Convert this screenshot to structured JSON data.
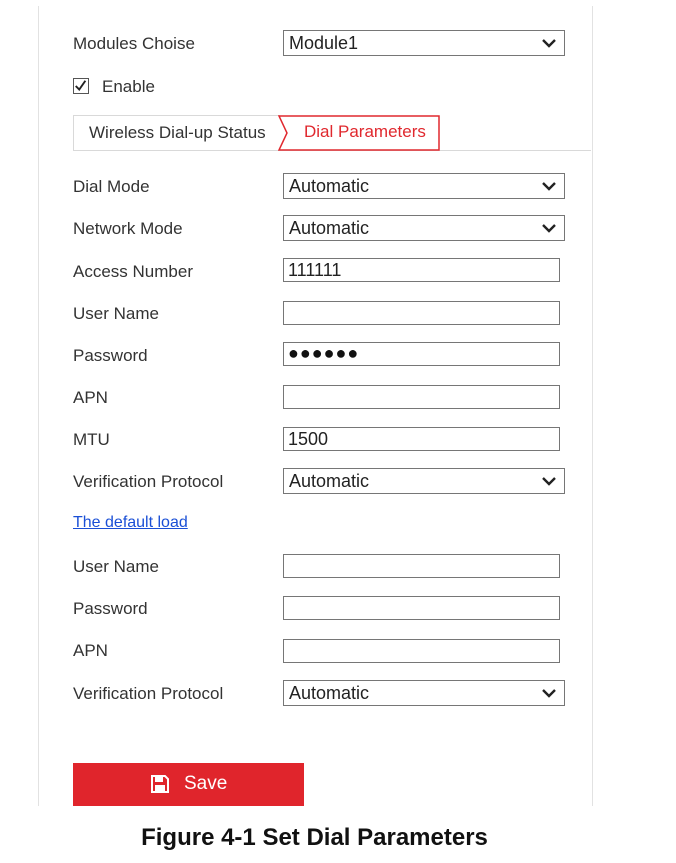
{
  "modules": {
    "label": "Modules Choise",
    "value": "Module1"
  },
  "enable": {
    "label": "Enable",
    "checked": true
  },
  "tabs": [
    {
      "label": "Wireless Dial-up Status",
      "active": false
    },
    {
      "label": "Dial Parameters",
      "active": true
    }
  ],
  "form": {
    "dial_mode": {
      "label": "Dial Mode",
      "value": "Automatic"
    },
    "network_mode": {
      "label": "Network Mode",
      "value": "Automatic"
    },
    "access_number": {
      "label": "Access Number",
      "value": "111111"
    },
    "user_name": {
      "label": "User Name",
      "value": ""
    },
    "password": {
      "label": "Password",
      "value": "●●●●●●"
    },
    "apn": {
      "label": "APN",
      "value": ""
    },
    "mtu": {
      "label": "MTU",
      "value": "1500"
    },
    "verification_protocol": {
      "label": "Verification Protocol",
      "value": "Automatic"
    }
  },
  "default_load": {
    "link_label": "The default load",
    "user_name": {
      "label": "User Name",
      "value": ""
    },
    "password": {
      "label": "Password",
      "value": ""
    },
    "apn": {
      "label": "APN",
      "value": ""
    },
    "verification_protocol": {
      "label": "Verification Protocol",
      "value": "Automatic"
    }
  },
  "save_button": {
    "label": "Save",
    "icon": "save-icon"
  },
  "caption": "Figure 4-1 Set Dial Parameters",
  "colors": {
    "accent": "#e0252c",
    "tab_active": "#e0282e",
    "link": "#1a4fd6"
  }
}
